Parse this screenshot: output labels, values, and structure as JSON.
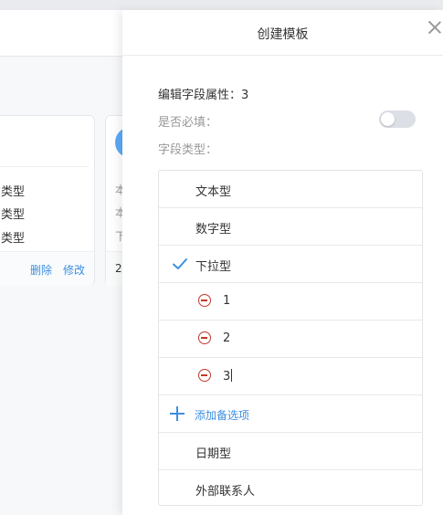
{
  "background": {
    "card1": {
      "lines": [
        "类型",
        "类型",
        "类型"
      ],
      "actions": {
        "delete": "删除",
        "edit": "修改"
      }
    },
    "card2": {
      "lines": [
        "本",
        "本",
        "下"
      ],
      "footer": "2"
    }
  },
  "drawer": {
    "title": "创建模板",
    "field_title": "编辑字段属性：3",
    "required_label": "是否必填：",
    "required_on": false,
    "type_label": "字段类型：",
    "types": {
      "text": "文本型",
      "number": "数字型",
      "dropdown": "下拉型",
      "date": "日期型",
      "contact": "外部联系人"
    },
    "selected_type": "dropdown",
    "options": [
      "1",
      "2",
      "3"
    ],
    "add_option": "添加备选项"
  },
  "colors": {
    "accent": "#3d8fe0",
    "remove": "#c0392b"
  }
}
